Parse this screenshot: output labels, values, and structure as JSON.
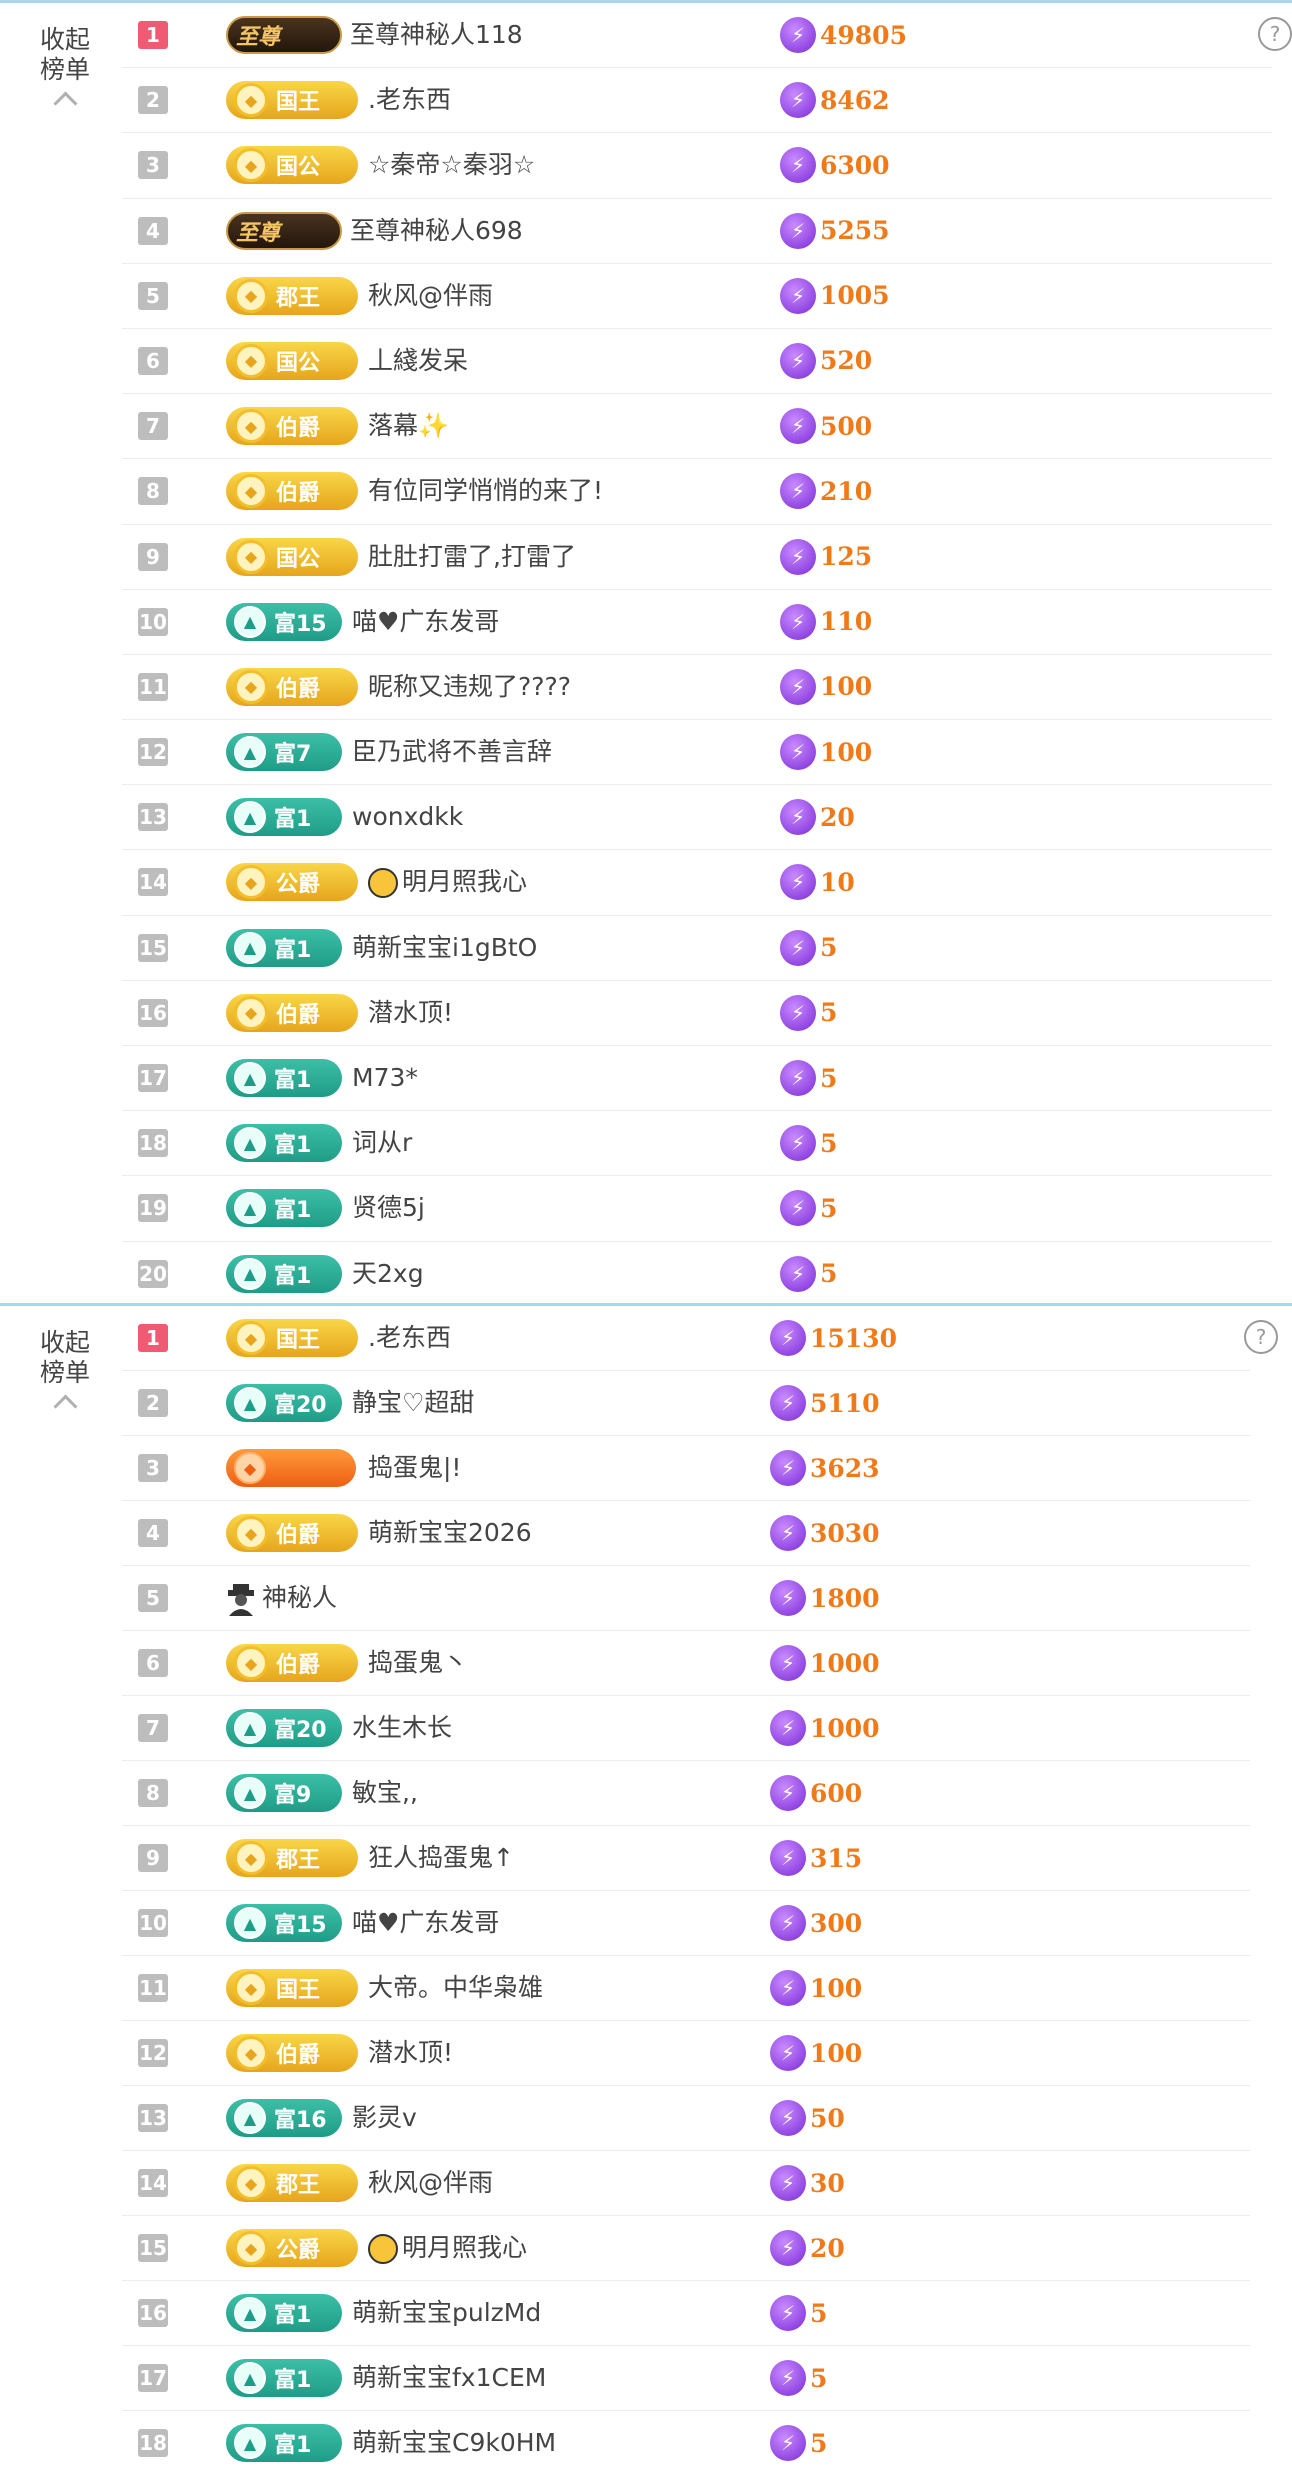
{
  "colors": {
    "accent_rank": "#f05b74",
    "score": "#f07a1a",
    "gold_badge": "#e6a51c",
    "green_badge": "#1f9c87"
  },
  "panel_a": {
    "side_label": "收起\n榜单",
    "help": "?",
    "rows": [
      {
        "rank": "1",
        "badge_type": "dark",
        "badge": "至尊",
        "name": "至尊神秘人118",
        "score": "49805"
      },
      {
        "rank": "2",
        "badge_type": "gold",
        "badge": "国王",
        "name": ".老东西",
        "score": "8462"
      },
      {
        "rank": "3",
        "badge_type": "gold",
        "badge": "国公",
        "name": "☆秦帝☆秦羽☆",
        "score": "6300"
      },
      {
        "rank": "4",
        "badge_type": "dark",
        "badge": "至尊",
        "name": "至尊神秘人698",
        "score": "5255"
      },
      {
        "rank": "5",
        "badge_type": "gold",
        "badge": "郡王",
        "name": "秋风@伴雨",
        "score": "1005"
      },
      {
        "rank": "6",
        "badge_type": "gold",
        "badge": "国公",
        "name": "丄綫发呆",
        "score": "520"
      },
      {
        "rank": "7",
        "badge_type": "gold",
        "badge": "伯爵",
        "name": "落幕✨",
        "score": "500"
      },
      {
        "rank": "8",
        "badge_type": "gold",
        "badge": "伯爵",
        "name": "有位同学悄悄的来了!",
        "score": "210"
      },
      {
        "rank": "9",
        "badge_type": "gold",
        "badge": "国公",
        "name": "肚肚打雷了,打雷了",
        "score": "125"
      },
      {
        "rank": "10",
        "badge_type": "green",
        "badge": "富15",
        "name": "喵♥广东发哥",
        "score": "110"
      },
      {
        "rank": "11",
        "badge_type": "gold",
        "badge": "伯爵",
        "name": "昵称又违规了????",
        "score": "100"
      },
      {
        "rank": "12",
        "badge_type": "green",
        "badge": "富7",
        "name": "臣乃武将不善言辞",
        "score": "100"
      },
      {
        "rank": "13",
        "badge_type": "green",
        "badge": "富1",
        "name": "wonxdkk",
        "score": "20"
      },
      {
        "rank": "14",
        "badge_type": "gold",
        "badge": "公爵",
        "name": "明月照我心",
        "score": "10",
        "emoji": true
      },
      {
        "rank": "15",
        "badge_type": "green",
        "badge": "富1",
        "name": "萌新宝宝i1gBtO",
        "score": "5"
      },
      {
        "rank": "16",
        "badge_type": "gold",
        "badge": "伯爵",
        "name": "潜水顶!",
        "score": "5"
      },
      {
        "rank": "17",
        "badge_type": "green",
        "badge": "富1",
        "name": "M73*",
        "score": "5"
      },
      {
        "rank": "18",
        "badge_type": "green",
        "badge": "富1",
        "name": "词从r",
        "score": "5"
      },
      {
        "rank": "19",
        "badge_type": "green",
        "badge": "富1",
        "name": "贤德5j",
        "score": "5"
      },
      {
        "rank": "20",
        "badge_type": "green",
        "badge": "富1",
        "name": "天2xg",
        "score": "5"
      }
    ]
  },
  "panel_b": {
    "side_label": "收起\n榜单",
    "help": "?",
    "rows": [
      {
        "rank": "1",
        "badge_type": "gold",
        "badge": "国王",
        "name": ".老东西",
        "score": "15130"
      },
      {
        "rank": "2",
        "badge_type": "green",
        "badge": "富20",
        "name": "静宝♡超甜",
        "score": "5110"
      },
      {
        "rank": "3",
        "badge_type": "orange",
        "badge": "",
        "name": "捣蛋鬼|!",
        "score": "3623"
      },
      {
        "rank": "4",
        "badge_type": "gold",
        "badge": "伯爵",
        "name": "萌新宝宝2026",
        "score": "3030"
      },
      {
        "rank": "5",
        "badge_type": "mystery",
        "badge": "",
        "name": "神秘人",
        "score": "1800"
      },
      {
        "rank": "6",
        "badge_type": "gold",
        "badge": "伯爵",
        "name": "捣蛋鬼丶",
        "score": "1000"
      },
      {
        "rank": "7",
        "badge_type": "green",
        "badge": "富20",
        "name": "水生木长",
        "score": "1000"
      },
      {
        "rank": "8",
        "badge_type": "green",
        "badge": "富9",
        "name": "敏宝,,",
        "score": "600"
      },
      {
        "rank": "9",
        "badge_type": "gold",
        "badge": "郡王",
        "name": "狂人捣蛋鬼↑",
        "score": "315"
      },
      {
        "rank": "10",
        "badge_type": "green",
        "badge": "富15",
        "name": "喵♥广东发哥",
        "score": "300"
      },
      {
        "rank": "11",
        "badge_type": "gold",
        "badge": "国王",
        "name": "大帝。中华枭雄",
        "score": "100"
      },
      {
        "rank": "12",
        "badge_type": "gold",
        "badge": "伯爵",
        "name": "潜水顶!",
        "score": "100"
      },
      {
        "rank": "13",
        "badge_type": "green",
        "badge": "富16",
        "name": "影灵v",
        "score": "50"
      },
      {
        "rank": "14",
        "badge_type": "gold",
        "badge": "郡王",
        "name": "秋风@伴雨",
        "score": "30"
      },
      {
        "rank": "15",
        "badge_type": "gold",
        "badge": "公爵",
        "name": "明月照我心",
        "score": "20",
        "emoji": true
      },
      {
        "rank": "16",
        "badge_type": "green",
        "badge": "富1",
        "name": "萌新宝宝pulzMd",
        "score": "5"
      },
      {
        "rank": "17",
        "badge_type": "green",
        "badge": "富1",
        "name": "萌新宝宝fx1CEM",
        "score": "5"
      },
      {
        "rank": "18",
        "badge_type": "green",
        "badge": "富1",
        "name": "萌新宝宝C9k0HM",
        "score": "5"
      }
    ]
  }
}
